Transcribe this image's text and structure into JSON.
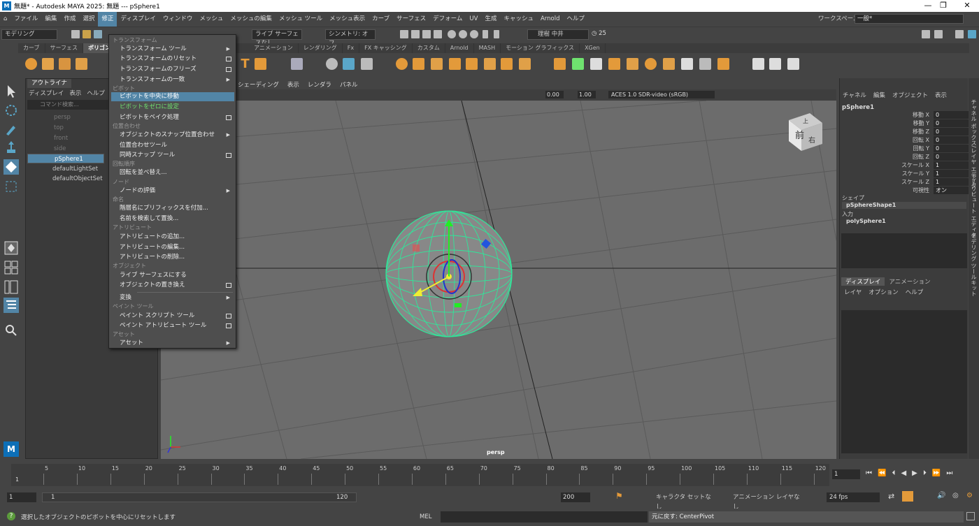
{
  "title_bar": {
    "logo": "M",
    "text": "無題* - Autodesk MAYA 2025: 無題   ---   pSphere1",
    "minimize": "—",
    "maximize": "❐",
    "close": "✕"
  },
  "menubar": {
    "items": [
      "ファイル",
      "編集",
      "作成",
      "選択",
      "修正",
      "ディスプレイ",
      "ウィンドウ",
      "メッシュ",
      "メッシュの編集",
      "メッシュ ツール",
      "メッシュ表示",
      "カーブ",
      "サーフェス",
      "デフォーム",
      "UV",
      "生成",
      "キャッシュ",
      "Arnold",
      "ヘルプ"
    ],
    "workspace_label": "ワークスペース:",
    "workspace_value": "一般*"
  },
  "statusline": {
    "mode": "モデリング",
    "live": "ライブ サーフェスなし",
    "symmetry": "シンメトリ: オフ",
    "user": "理樹 中井",
    "count": "25"
  },
  "shelf_tabs": [
    "カーブ",
    "サーフェス",
    "ポリゴン",
    "アニメーション",
    "レンダリング",
    "Fx",
    "FX キャッシング",
    "カスタム",
    "Arnold",
    "MASH",
    "モーション グラフィックス",
    "XGen"
  ],
  "outliner": {
    "tab": "アウトライナ",
    "menu": [
      "ディスプレイ",
      "表示",
      "ヘルプ"
    ],
    "search_placeholder": "コマンド検索...",
    "items": [
      "persp",
      "top",
      "front",
      "side",
      "pSphere1",
      "defaultLightSet",
      "defaultObjectSet"
    ]
  },
  "dropdown": {
    "sections": [
      "トランスフォーム",
      "ピボット",
      "位置合わせ",
      "回転順序",
      "ノード",
      "命名",
      "アトリビュート",
      "オブジェクト",
      "ペイント ツール",
      "アセット"
    ],
    "items": [
      "トランスフォーム ツール",
      "トランスフォームのリセット",
      "トランスフォームのフリーズ",
      "トランスフォームの一致",
      "ピボットを中央に移動",
      "ピボットをゼロに設定",
      "ピボットをベイク処理",
      "オブジェクトのスナップ位置合わせ",
      "位置合わせツール",
      "同時スナップ ツール",
      "回転を並べ替え...",
      "ノードの評価",
      "階層名にプリフィックスを付加...",
      "名前を検索して置換...",
      "アトリビュートの追加...",
      "アトリビュートの編集...",
      "アトリビュートの削除...",
      "ライブ サーフェスにする",
      "オブジェクトの置き換え",
      "変換",
      "ペイント スクリプト ツール",
      "ペイント アトリビュート ツール",
      "アセット"
    ]
  },
  "viewport": {
    "menu": [
      "シェーディング",
      "表示",
      "レンダラ",
      "パネル"
    ],
    "val1": "0.00",
    "val2": "1.00",
    "colorspace": "ACES 1.0 SDR-video (sRGB)",
    "camera_label": "persp",
    "cube_front": "前",
    "cube_right": "右",
    "cube_top": "上"
  },
  "channelbox": {
    "menu": [
      "チャネル",
      "編集",
      "オブジェクト",
      "表示"
    ],
    "object": "pSphere1",
    "attrs": [
      [
        "移動 X",
        "0"
      ],
      [
        "移動 Y",
        "0"
      ],
      [
        "移動 Z",
        "0"
      ],
      [
        "回転 X",
        "0"
      ],
      [
        "回転 Y",
        "0"
      ],
      [
        "回転 Z",
        "0"
      ],
      [
        "スケール X",
        "1"
      ],
      [
        "スケール Y",
        "1"
      ],
      [
        "スケール Z",
        "1"
      ],
      [
        "可視性",
        "オン"
      ]
    ],
    "shape_label": "シェイプ",
    "shape_name": "pSphereShape1",
    "input_label": "入力",
    "input_name": "polySphere1",
    "layer_tabs": [
      "ディスプレイ",
      "アニメーション"
    ],
    "layer_menu": [
      "レイヤ",
      "オプション",
      "ヘルプ"
    ]
  },
  "side_tabs": [
    "チャネル ボックス/レイヤ エディタ",
    "アトリビュート エディタ",
    "モデリング ツールキット"
  ],
  "timeline": {
    "ticks": [
      "5",
      "10",
      "15",
      "20",
      "25",
      "30",
      "35",
      "40",
      "45",
      "50",
      "55",
      "60",
      "65",
      "70",
      "75",
      "80",
      "85",
      "90",
      "95",
      "100",
      "105",
      "110",
      "115",
      "120"
    ],
    "start_mark": "1",
    "current": "1"
  },
  "range": {
    "start": "1",
    "inner_start": "1",
    "inner_end": "120",
    "end": "200",
    "character": "キャラクタ セットなし",
    "anim_layer": "アニメーション レイヤなし",
    "fps": "24 fps"
  },
  "cmdline": {
    "help": "選択したオブジェクトのピボットを中心にリセットします",
    "mel": "MEL",
    "result": "元に戻す: CenterPivot"
  }
}
